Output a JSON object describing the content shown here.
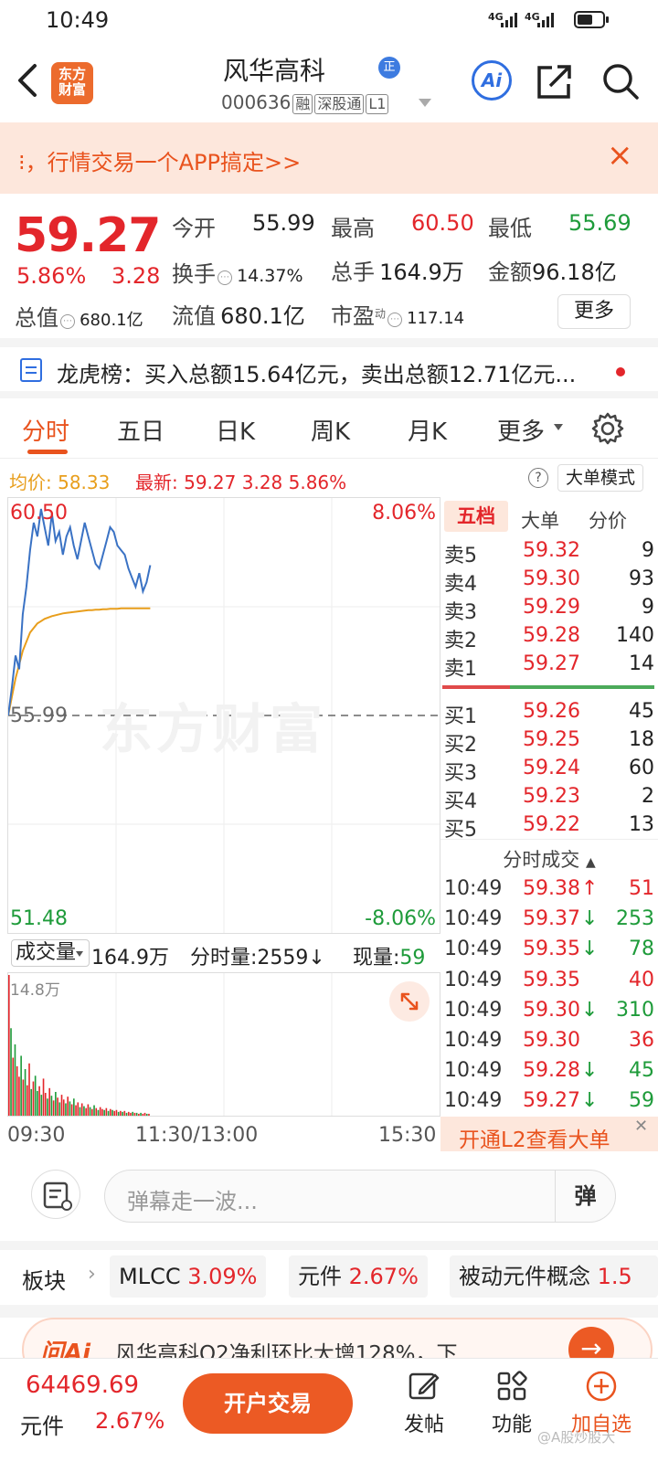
{
  "status_bar": {
    "time": "10:49",
    "signal1": "4G",
    "signal2": "4G"
  },
  "header": {
    "logo_line1": "东方",
    "logo_line2": "财富",
    "stock_name": "风华高科",
    "badge": "正",
    "code": "000636",
    "tags": [
      "融",
      "深股通",
      "L1"
    ],
    "ai_label": "Ai"
  },
  "banner": {
    "text": "⁝，行情交易一个APP搞定>>",
    "close": "×"
  },
  "quote": {
    "price": "59.27",
    "change_pct": "5.86%",
    "change_amt": "3.28",
    "open_label": "今开",
    "open": "55.99",
    "high_label": "最高",
    "high": "60.50",
    "low_label": "最低",
    "low": "55.69",
    "turnover_label": "换手",
    "turnover": "14.37%",
    "volume_label": "总手",
    "volume": "164.9万",
    "amount_label": "金额",
    "amount": "96.18亿",
    "mktcap_label": "总值",
    "mktcap": "680.1亿",
    "float_label": "流值",
    "float": "680.1亿",
    "pe_label": "市盈",
    "pe_sup": "动",
    "pe": "117.14",
    "more": "更多"
  },
  "dragon": {
    "text": "龙虎榜：买入总额15.64亿元，卖出总额12.71亿元..."
  },
  "tabs": [
    "分时",
    "五日",
    "日K",
    "周K",
    "月K",
    "更多"
  ],
  "avg_row": {
    "avg_label": "均价:",
    "avg": "58.33",
    "new_label": "最新:",
    "new_price": "59.27",
    "new_chg": "3.28",
    "new_pct": "5.86%",
    "help": "?",
    "big_mode": "大单模式"
  },
  "chart_data": {
    "type": "line",
    "top_price": "60.50",
    "top_pct": "8.06%",
    "mid_price": "55.99",
    "bottom_price": "51.48",
    "bottom_pct": "-8.06%",
    "watermark": "东方财富",
    "ylim": [
      51.48,
      60.5
    ],
    "prev_close": 55.99,
    "price_series": [
      55.99,
      56.6,
      57.3,
      57.0,
      58.2,
      58.8,
      59.6,
      60.2,
      59.9,
      60.5,
      60.1,
      59.7,
      60.4,
      59.8,
      60.0,
      59.5,
      59.9,
      60.1,
      59.7,
      59.4,
      59.8,
      60.2,
      59.9,
      59.6,
      59.3,
      59.2,
      59.5,
      59.8,
      60.1,
      60.0,
      59.7,
      59.6,
      59.5,
      59.2,
      59.0,
      58.8,
      59.1,
      58.7,
      58.9,
      59.27
    ],
    "avg_series": [
      55.99,
      56.4,
      56.8,
      57.1,
      57.4,
      57.6,
      57.8,
      57.9,
      58.0,
      58.05,
      58.1,
      58.13,
      58.16,
      58.18,
      58.2,
      58.22,
      58.23,
      58.24,
      58.25,
      58.26,
      58.27,
      58.28,
      58.29,
      58.29,
      58.3,
      58.3,
      58.31,
      58.31,
      58.32,
      58.32,
      58.32,
      58.33,
      58.33,
      58.33,
      58.33,
      58.33,
      58.33,
      58.33,
      58.33,
      58.33
    ],
    "sessions_minutes": 240,
    "elapsed_minutes": 79,
    "volume_max_label": "14.8万",
    "volume_bars": [
      14.8,
      9.2,
      6.1,
      7.5,
      5.2,
      4.1,
      6.3,
      3.8,
      4.9,
      3.2,
      5.5,
      2.8,
      3.6,
      4.2,
      2.6,
      3.1,
      2.2,
      3.9,
      2.4,
      1.8,
      2.9,
      2.1,
      1.6,
      2.5,
      1.9,
      1.4,
      2.2,
      1.7,
      1.3,
      2.0,
      1.5,
      1.2,
      1.8,
      1.1,
      1.4,
      0.9,
      1.3,
      1.0,
      0.8,
      1.2,
      0.9,
      0.7,
      1.1,
      0.8,
      0.6,
      0.9,
      0.7,
      0.6,
      0.8,
      0.5,
      0.7,
      0.6,
      0.5,
      0.6,
      0.4,
      0.5,
      0.4,
      0.5,
      0.3,
      0.4,
      0.3,
      0.4,
      0.3,
      0.3,
      0.2,
      0.3,
      0.2,
      0.3,
      0.2,
      0.2
    ],
    "volume_colors": [
      "r",
      "g",
      "r",
      "g",
      "r",
      "r",
      "g",
      "r",
      "g",
      "r",
      "r",
      "g",
      "r",
      "g",
      "g",
      "r",
      "g",
      "r",
      "r",
      "g",
      "r",
      "g",
      "r",
      "g",
      "r",
      "g",
      "r",
      "r",
      "g",
      "r",
      "g",
      "r",
      "g",
      "r",
      "r",
      "g",
      "r",
      "g",
      "r",
      "r",
      "g",
      "r",
      "g",
      "r",
      "g",
      "r",
      "r",
      "g",
      "r",
      "g",
      "r",
      "g",
      "r",
      "r",
      "g",
      "r",
      "g",
      "r",
      "g",
      "r",
      "r",
      "g",
      "r",
      "g",
      "r",
      "g",
      "r",
      "r",
      "g",
      "r"
    ],
    "x_labels": [
      "09:30",
      "11:30/13:00",
      "15:30"
    ]
  },
  "volume_header": {
    "selector": "成交量",
    "total": "164.9万",
    "minute_label": "分时量:",
    "minute_val": "2559",
    "current_label": "现量:",
    "current_val": "59"
  },
  "order_book": {
    "tabs": [
      "五档",
      "大单",
      "分价"
    ],
    "asks": [
      {
        "side": "卖5",
        "price": "59.32",
        "vol": "9"
      },
      {
        "side": "卖4",
        "price": "59.30",
        "vol": "93"
      },
      {
        "side": "卖3",
        "price": "59.29",
        "vol": "9"
      },
      {
        "side": "卖2",
        "price": "59.28",
        "vol": "140"
      },
      {
        "side": "卖1",
        "price": "59.27",
        "vol": "14"
      }
    ],
    "bids": [
      {
        "side": "买1",
        "price": "59.26",
        "vol": "45"
      },
      {
        "side": "买2",
        "price": "59.25",
        "vol": "18"
      },
      {
        "side": "买3",
        "price": "59.24",
        "vol": "60"
      },
      {
        "side": "买4",
        "price": "59.23",
        "vol": "2"
      },
      {
        "side": "买5",
        "price": "59.22",
        "vol": "13"
      }
    ],
    "trades_header": "分时成交",
    "trades": [
      {
        "time": "10:49",
        "price": "59.38",
        "dir": "↑",
        "vol": "51",
        "color": "red"
      },
      {
        "time": "10:49",
        "price": "59.37",
        "dir": "↓",
        "vol": "253",
        "color": "green"
      },
      {
        "time": "10:49",
        "price": "59.35",
        "dir": "↓",
        "vol": "78",
        "color": "green"
      },
      {
        "time": "10:49",
        "price": "59.35",
        "dir": "",
        "vol": "40",
        "color": "red"
      },
      {
        "time": "10:49",
        "price": "59.30",
        "dir": "↓",
        "vol": "310",
        "color": "green"
      },
      {
        "time": "10:49",
        "price": "59.30",
        "dir": "",
        "vol": "36",
        "color": "red"
      },
      {
        "time": "10:49",
        "price": "59.28",
        "dir": "↓",
        "vol": "45",
        "color": "green"
      },
      {
        "time": "10:49",
        "price": "59.27",
        "dir": "↓",
        "vol": "59",
        "color": "green"
      }
    ],
    "l2_text": "开通L2查看大单"
  },
  "comment": {
    "placeholder": "弹幕走一波...",
    "dan": "弹"
  },
  "sector": {
    "label": "板块",
    "chips": [
      {
        "name": "MLCC",
        "pct": "3.09%"
      },
      {
        "name": "元件",
        "pct": "2.67%"
      },
      {
        "name": "被动元件概念",
        "pct": "1.5"
      }
    ]
  },
  "news": {
    "ai": "问Ai",
    "text": "风华高科Q2净利环比大增128%，下"
  },
  "bottom": {
    "index_value": "64469.69",
    "index_name": "元件",
    "index_pct": "2.67%",
    "trade_btn": "开户交易",
    "nav": [
      "发帖",
      "功能",
      "加自选"
    ],
    "watermark": "@A股炒股大"
  },
  "colors": {
    "up": "#e3262b",
    "down": "#1e9b3a",
    "accent": "#ec5a24",
    "price_line": "#3a72c4",
    "avg_line": "#e89e1c"
  }
}
